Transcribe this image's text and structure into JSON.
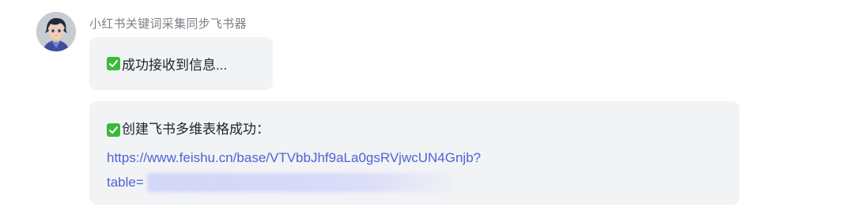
{
  "sender": {
    "name": "小红书关键词采集同步飞书器"
  },
  "messages": [
    {
      "icon": "check-mark-icon",
      "text": "成功接收到信息..."
    },
    {
      "icon": "check-mark-icon",
      "title": "创建飞书多维表格成功：",
      "link_line1": "https://www.feishu.cn/base/VTVbbJhf9aLa0gsRVjwcUN4Gnjb?",
      "link_line2": "table="
    }
  ],
  "colors": {
    "bubble_bg": "#f2f3f5",
    "link": "#4e62d8",
    "check": "#3bba3b",
    "sender_text": "#7c7f86"
  }
}
